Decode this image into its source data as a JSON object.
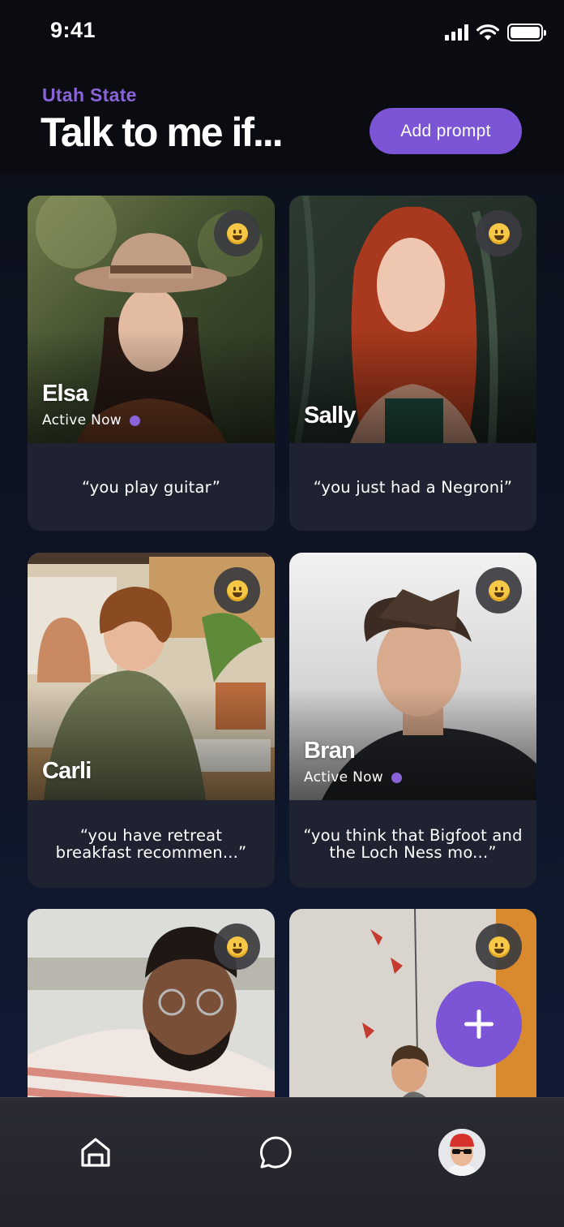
{
  "status_bar": {
    "time": "9:41"
  },
  "header": {
    "school": "Utah State",
    "title": "Talk to me if...",
    "add_prompt_label": "Add prompt"
  },
  "cards": [
    {
      "name": "Elsa",
      "active": "Active Now",
      "prompt": "“you play guitar”"
    },
    {
      "name": "Sally",
      "active": "",
      "prompt": "“you just had a Negroni”"
    },
    {
      "name": "Carli",
      "active": "",
      "prompt": "“you have retreat breakfast recommen...”"
    },
    {
      "name": "Bran",
      "active": "Active Now",
      "prompt": "“you think that Bigfoot and the Loch Ness mo...”"
    },
    {
      "name": "",
      "active": "",
      "prompt": ""
    },
    {
      "name": "",
      "active": "",
      "prompt": ""
    }
  ],
  "icons": {
    "emoji": "grinning-face-icon",
    "fab": "plus-icon",
    "tab_home": "home-icon",
    "tab_chat": "chat-bubble-icon",
    "tab_profile": "avatar"
  },
  "colors": {
    "accent": "#7b55d6",
    "school_label": "#8a63d9",
    "card_bg": "#1f2331",
    "background": "#0e1526"
  }
}
